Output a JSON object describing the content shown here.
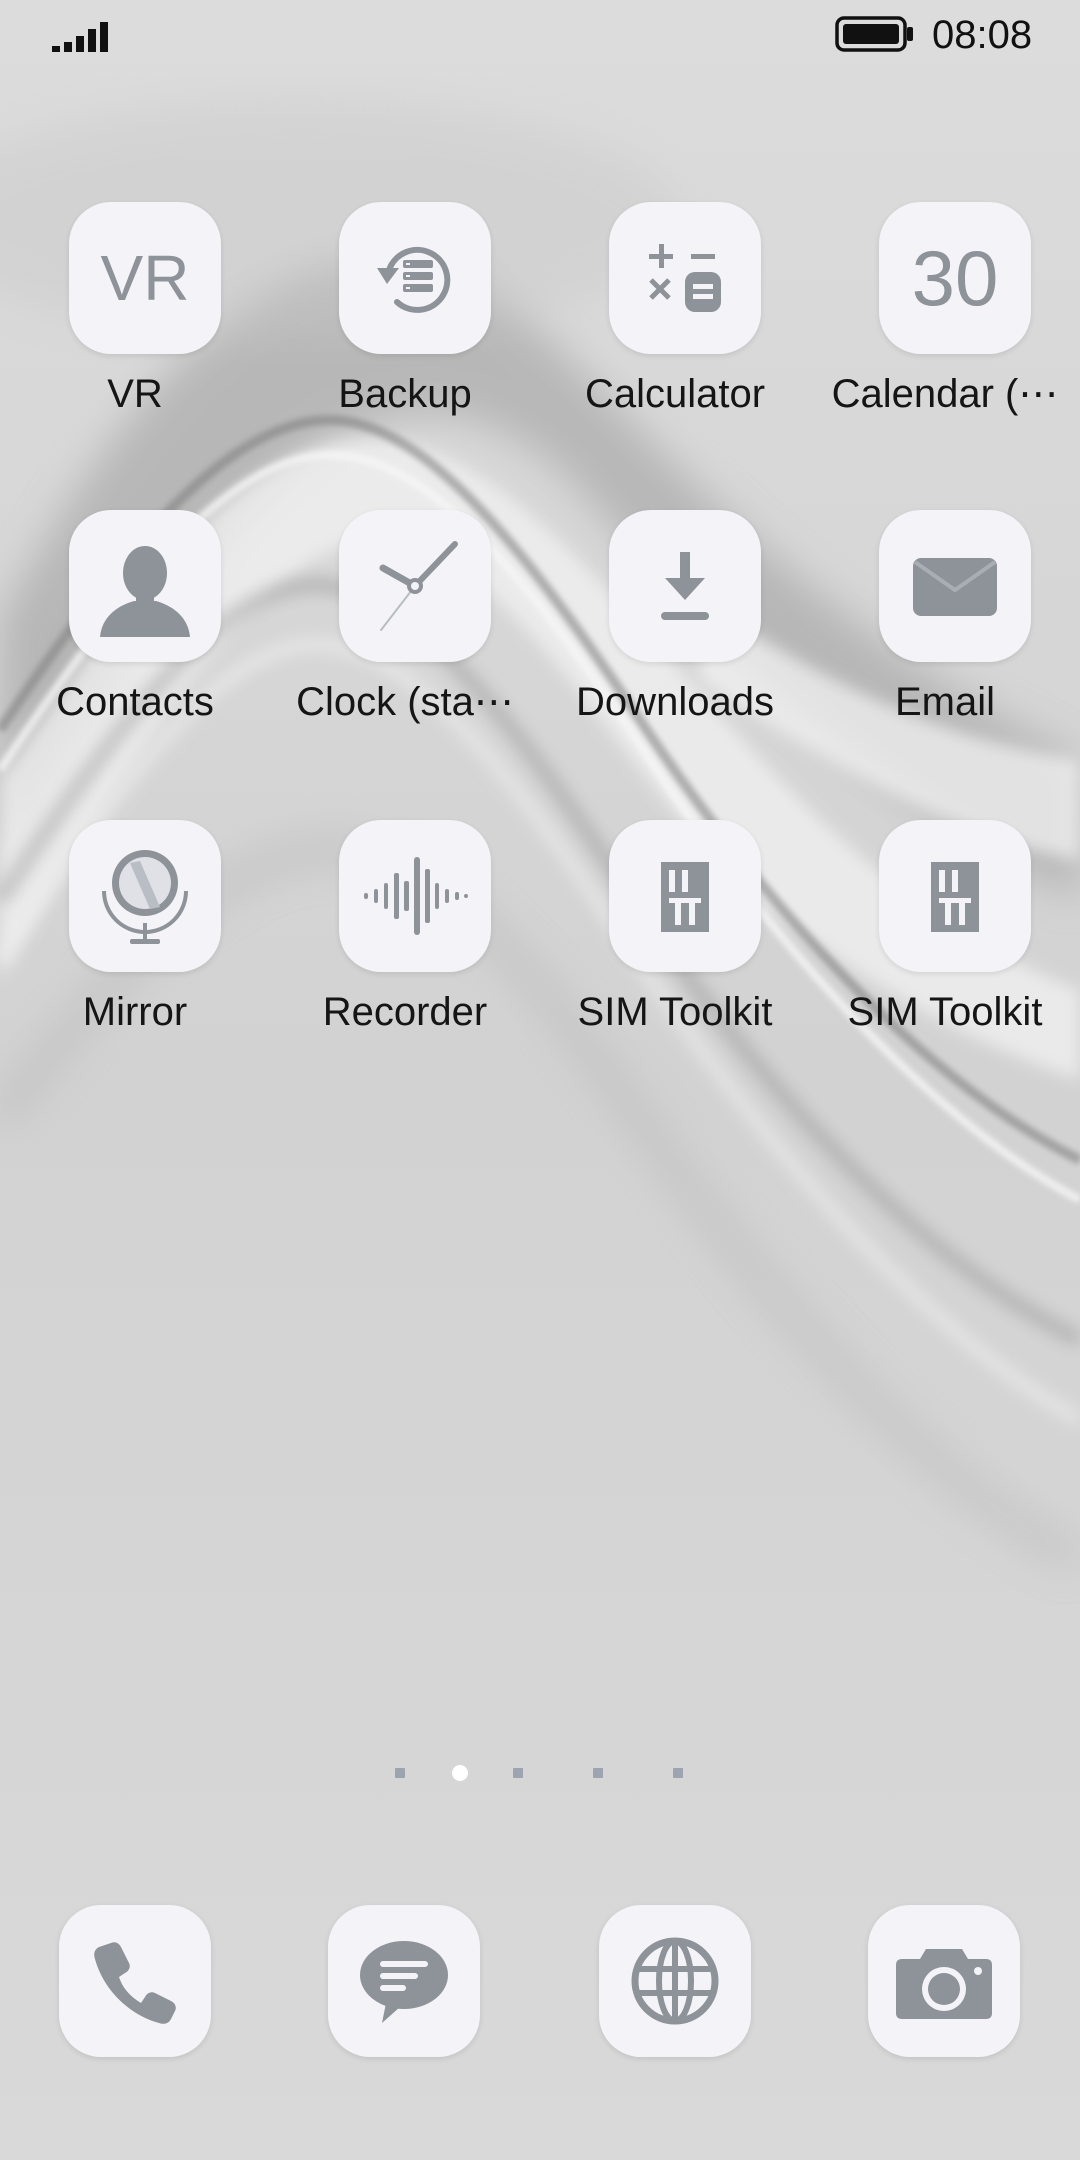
{
  "status_bar": {
    "time": "08:08",
    "signal_icon": "signal-bars-icon",
    "battery_icon": "battery-full-icon"
  },
  "apps": [
    {
      "label": "VR",
      "icon": "vr-text-icon",
      "icon_text": "VR"
    },
    {
      "label": "Backup",
      "icon": "backup-icon"
    },
    {
      "label": "Calculator",
      "icon": "calculator-icon"
    },
    {
      "label": "Calendar (⋯",
      "icon": "calendar-icon",
      "icon_text": "30"
    },
    {
      "label": "Contacts",
      "icon": "contacts-icon"
    },
    {
      "label": "Clock (sta⋯",
      "icon": "clock-icon"
    },
    {
      "label": "Downloads",
      "icon": "download-icon"
    },
    {
      "label": "Email",
      "icon": "email-icon"
    },
    {
      "label": "Mirror",
      "icon": "mirror-icon"
    },
    {
      "label": "Recorder",
      "icon": "recorder-icon"
    },
    {
      "label": "SIM Toolkit",
      "icon": "sim-card-icon"
    },
    {
      "label": "SIM Toolkit",
      "icon": "sim-card-icon"
    }
  ],
  "page_indicator": {
    "pages": 5,
    "current": 2
  },
  "dock": [
    {
      "icon": "phone-icon"
    },
    {
      "icon": "messages-icon"
    },
    {
      "icon": "browser-globe-icon"
    },
    {
      "icon": "camera-icon"
    }
  ],
  "colors": {
    "icon_tile": "#f4f4f8",
    "icon_glyph": "#8e9299",
    "label_text": "#151515",
    "wallpaper_base": "#d7d7d7"
  }
}
